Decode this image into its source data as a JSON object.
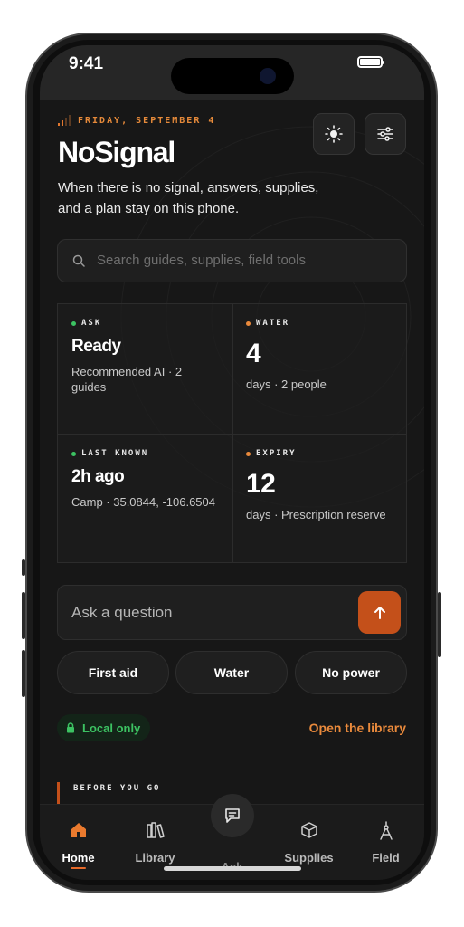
{
  "status": {
    "time": "9:41"
  },
  "header": {
    "date": "FRIDAY, SEPTEMBER 4",
    "title": "NoSignal",
    "subtitle": "When there is no signal, answers, supplies, and a plan stay on this phone."
  },
  "icons": {
    "theme": "sun-icon",
    "settings": "sliders-icon",
    "search": "search-icon",
    "send": "arrow-up-icon",
    "lock": "lock-icon",
    "signal": "signal-bars-icon"
  },
  "search": {
    "placeholder": "Search guides, supplies, field tools"
  },
  "cards": [
    {
      "label": "ASK",
      "dot_color": "#3cc262",
      "value": "Ready",
      "note": "Recommended AI · 2 guides"
    },
    {
      "label": "WATER",
      "dot_color": "#ea8a3c",
      "value": "4",
      "note": "days · 2 people"
    },
    {
      "label": "LAST KNOWN",
      "dot_color": "#3cc262",
      "value": "2h ago",
      "note": "Camp · 35.0844, -106.6504"
    },
    {
      "label": "EXPIRY",
      "dot_color": "#ea8a3c",
      "value": "12",
      "note": "days · Prescription reserve"
    }
  ],
  "ask": {
    "placeholder": "Ask a question"
  },
  "chips": [
    "First aid",
    "Water",
    "No power"
  ],
  "badge": {
    "label": "Local only"
  },
  "library_link": "Open the library",
  "section": {
    "label": "BEFORE YOU GO"
  },
  "tabs": [
    {
      "label": "Home",
      "icon": "home-icon",
      "active": true
    },
    {
      "label": "Library",
      "icon": "books-icon",
      "active": false
    },
    {
      "label": "Ask",
      "icon": "chat-icon",
      "active": false
    },
    {
      "label": "Supplies",
      "icon": "box-icon",
      "active": false
    },
    {
      "label": "Field",
      "icon": "compass-icon",
      "active": false
    }
  ],
  "colors": {
    "accent": "#c4501a",
    "accent_text": "#ea8a3c",
    "ok": "#3cc262",
    "background": "#171717"
  }
}
